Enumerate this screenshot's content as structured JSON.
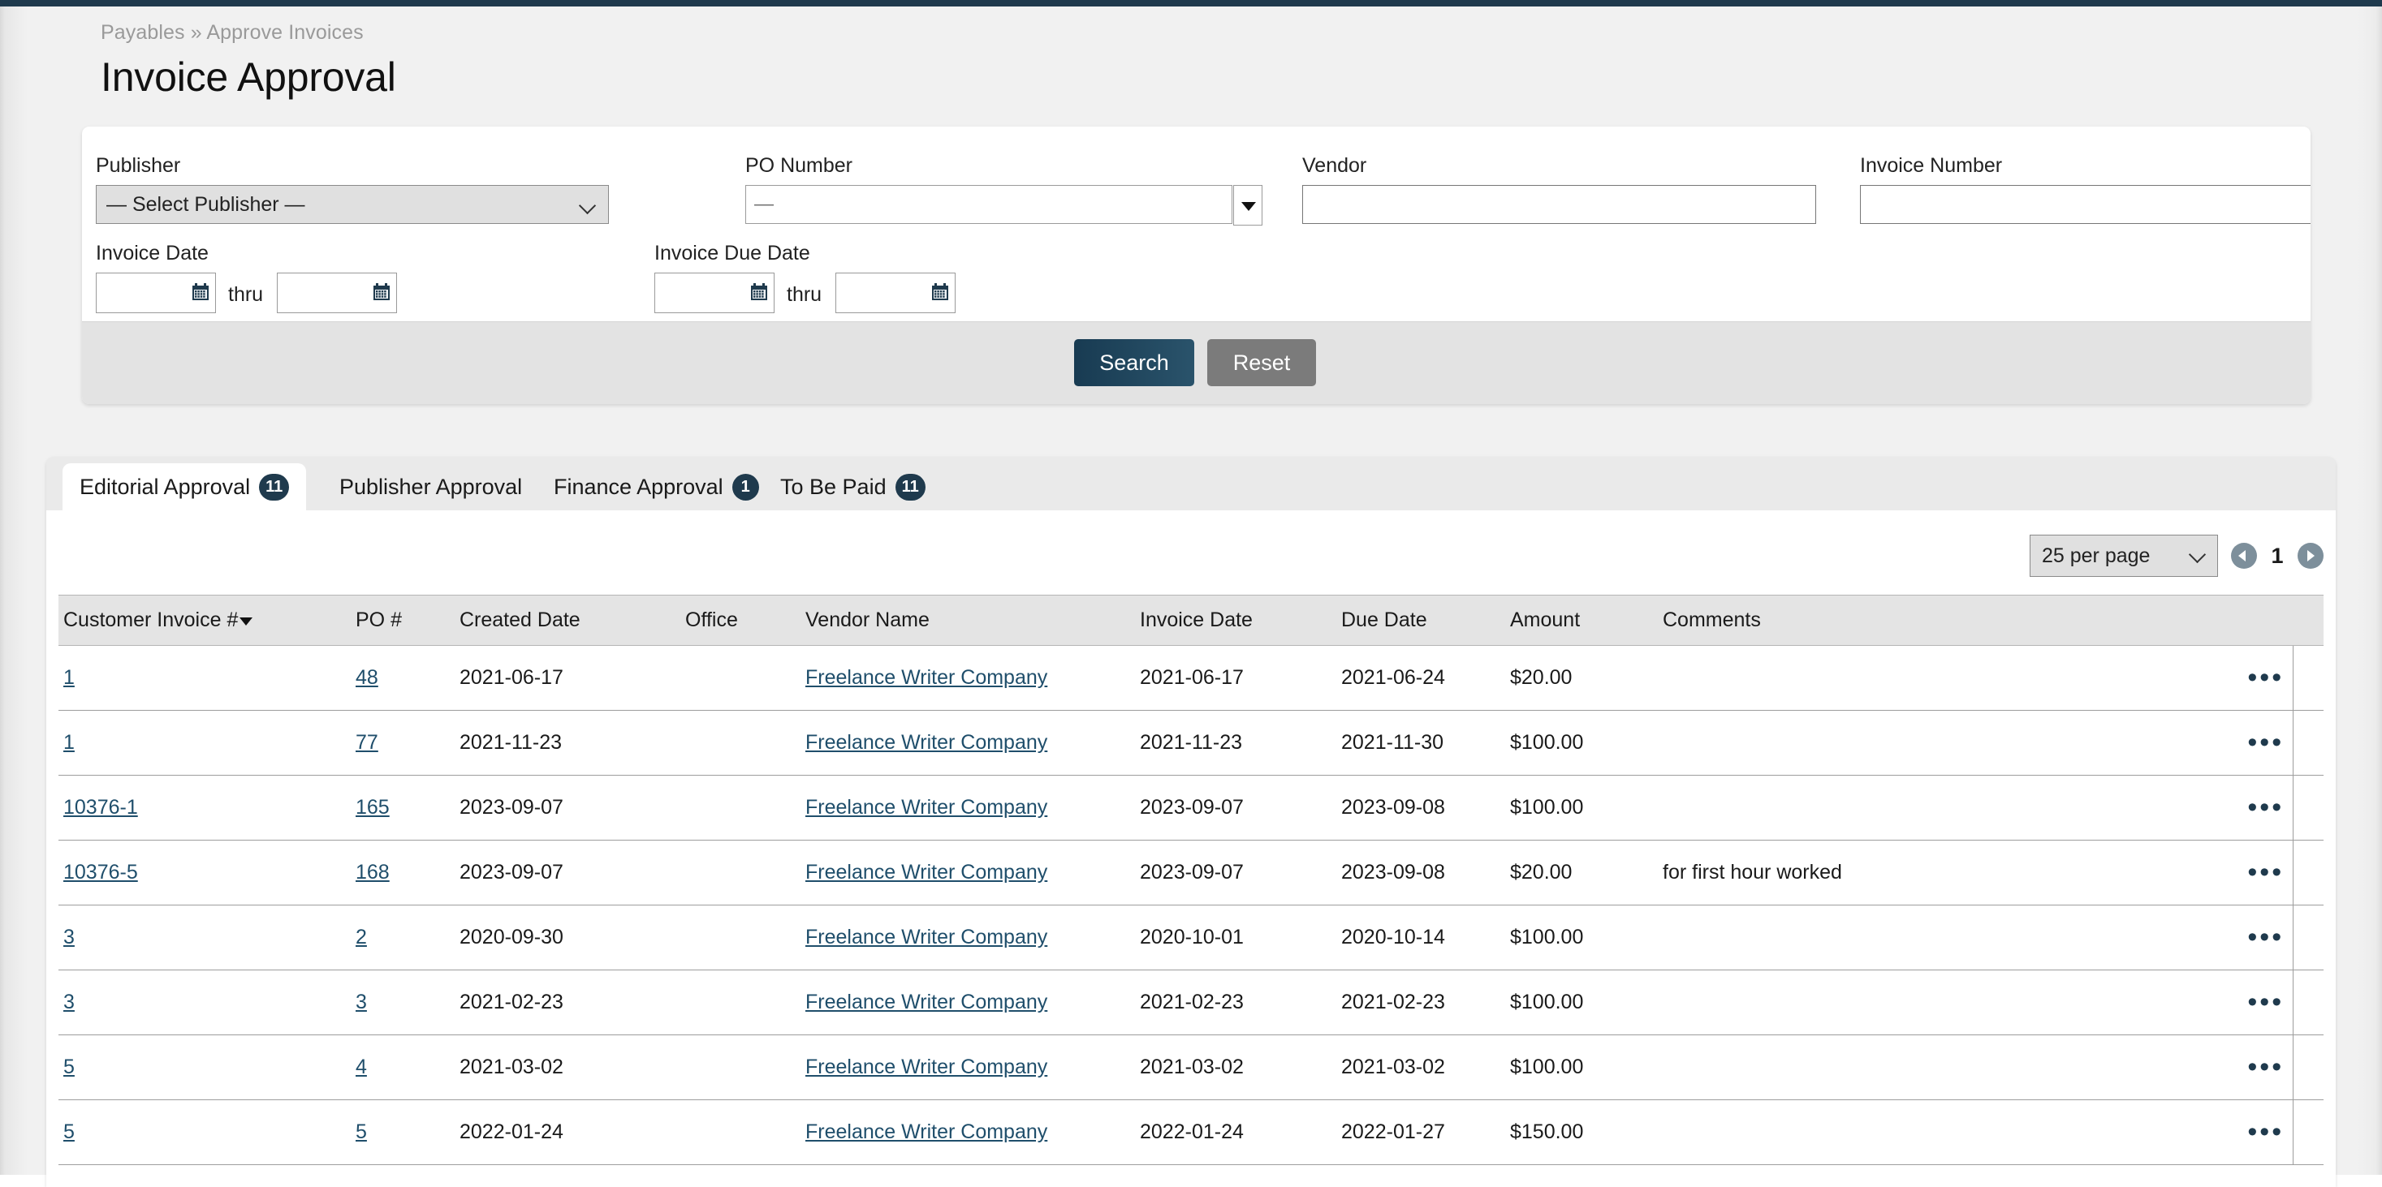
{
  "breadcrumb": "Payables » Approve Invoices",
  "page_title": "Invoice Approval",
  "colors": {
    "accent": "#1f3a4d",
    "link": "#1f4e6b",
    "reset": "#7b7b7b",
    "badge": "#1f3a4d"
  },
  "filters": {
    "publisher": {
      "label": "Publisher",
      "value": "— Select Publisher —"
    },
    "po_number": {
      "label": "PO Number",
      "value": "—"
    },
    "vendor": {
      "label": "Vendor",
      "value": ""
    },
    "invoice_number": {
      "label": "Invoice Number",
      "value": ""
    },
    "invoice_date": {
      "label": "Invoice Date",
      "from": "",
      "to": "",
      "thru": "thru"
    },
    "invoice_due_date": {
      "label": "Invoice Due Date",
      "from": "",
      "to": "",
      "thru": "thru"
    },
    "search_label": "Search",
    "reset_label": "Reset"
  },
  "tabs": [
    {
      "label": "Editorial Approval",
      "badge": "11",
      "active": true
    },
    {
      "label": "Publisher Approval",
      "badge": "",
      "active": false
    },
    {
      "label": "Finance Approval",
      "badge": "1",
      "active": false
    },
    {
      "label": "To Be Paid",
      "badge": "11",
      "active": false
    }
  ],
  "pager": {
    "per_page": "25 per page",
    "page": "1"
  },
  "table": {
    "columns": [
      "Customer Invoice #",
      "PO #",
      "Created Date",
      "Office",
      "Vendor Name",
      "Invoice Date",
      "Due Date",
      "Amount",
      "Comments",
      "",
      ""
    ],
    "sorted_column": "Customer Invoice #",
    "sort_direction": "desc",
    "rows": [
      {
        "customer_invoice": "1",
        "po": "48",
        "created": "2021-06-17",
        "office": "",
        "vendor": "Freelance Writer Company",
        "invoice_date": "2021-06-17",
        "due_date": "2021-06-24",
        "amount": "$20.00",
        "comments": ""
      },
      {
        "customer_invoice": "1",
        "po": "77",
        "created": "2021-11-23",
        "office": "",
        "vendor": "Freelance Writer Company",
        "invoice_date": "2021-11-23",
        "due_date": "2021-11-30",
        "amount": "$100.00",
        "comments": ""
      },
      {
        "customer_invoice": "10376-1",
        "po": "165",
        "created": "2023-09-07",
        "office": "",
        "vendor": "Freelance Writer Company",
        "invoice_date": "2023-09-07",
        "due_date": "2023-09-08",
        "amount": "$100.00",
        "comments": ""
      },
      {
        "customer_invoice": "10376-5",
        "po": "168",
        "created": "2023-09-07",
        "office": "",
        "vendor": "Freelance Writer Company",
        "invoice_date": "2023-09-07",
        "due_date": "2023-09-08",
        "amount": "$20.00",
        "comments": "for first hour worked"
      },
      {
        "customer_invoice": "3",
        "po": "2",
        "created": "2020-09-30",
        "office": "",
        "vendor": "Freelance Writer Company",
        "invoice_date": "2020-10-01",
        "due_date": "2020-10-14",
        "amount": "$100.00",
        "comments": ""
      },
      {
        "customer_invoice": "3",
        "po": "3",
        "created": "2021-02-23",
        "office": "",
        "vendor": "Freelance Writer Company",
        "invoice_date": "2021-02-23",
        "due_date": "2021-02-23",
        "amount": "$100.00",
        "comments": ""
      },
      {
        "customer_invoice": "5",
        "po": "4",
        "created": "2021-03-02",
        "office": "",
        "vendor": "Freelance Writer Company",
        "invoice_date": "2021-03-02",
        "due_date": "2021-03-02",
        "amount": "$100.00",
        "comments": ""
      },
      {
        "customer_invoice": "5",
        "po": "5",
        "created": "2022-01-24",
        "office": "",
        "vendor": "Freelance Writer Company",
        "invoice_date": "2022-01-24",
        "due_date": "2022-01-27",
        "amount": "$150.00",
        "comments": ""
      }
    ],
    "row_action_icon": "•••"
  }
}
